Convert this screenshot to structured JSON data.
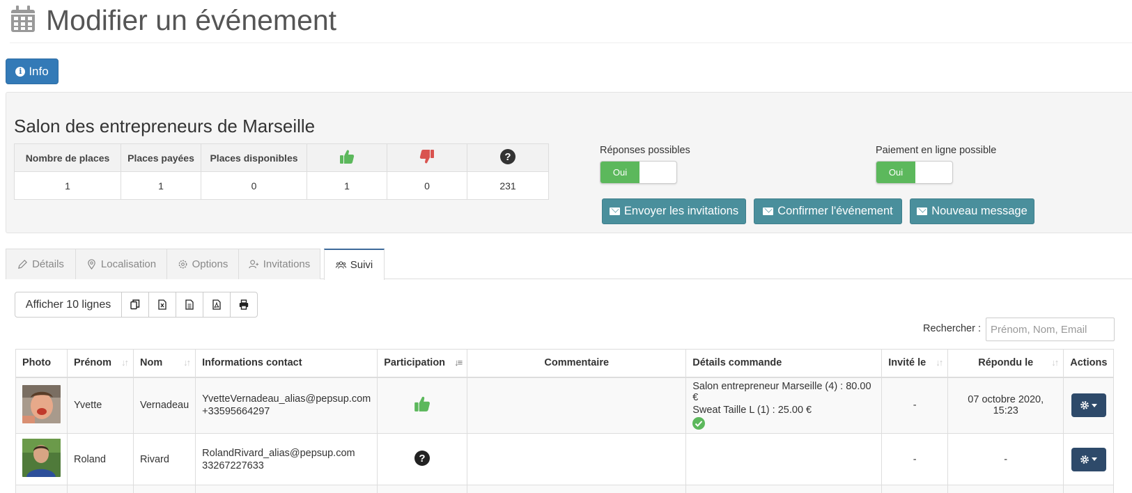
{
  "header": {
    "title": "Modifier un événement",
    "icon": "calendar-icon"
  },
  "info_button": {
    "label": "Info",
    "icon": "info-circle-icon"
  },
  "event": {
    "name": "Salon des entrepreneurs de Marseille",
    "stats_headers": [
      "Nombre de places",
      "Places payées",
      "Places disponibles"
    ],
    "stats_icons": [
      "thumbs-up-icon",
      "thumbs-down-icon",
      "question-circle-icon"
    ],
    "stats_values": [
      "1",
      "1",
      "0",
      "1",
      "0",
      "231"
    ]
  },
  "settings": {
    "responses_label": "Réponses possibles",
    "responses_value": "Oui",
    "payment_label": "Paiement en ligne possible",
    "payment_value": "Oui"
  },
  "actions": {
    "send_invitations": "Envoyer les invitations",
    "confirm_event": "Confirmer l'événement",
    "new_message": "Nouveau message"
  },
  "tabs": [
    {
      "label": "Détails",
      "icon": "pencil-icon"
    },
    {
      "label": "Localisation",
      "icon": "map-pin-icon"
    },
    {
      "label": "Options",
      "icon": "cog-icon"
    },
    {
      "label": "Invitations",
      "icon": "user-plus-icon"
    },
    {
      "label": "Suivi",
      "icon": "users-icon",
      "active": true
    }
  ],
  "table_tools": {
    "show_rows": "Afficher 10 lignes",
    "icons": [
      "copy-icon",
      "excel-icon",
      "csv-icon",
      "pdf-icon",
      "print-icon"
    ]
  },
  "search": {
    "label": "Rechercher :",
    "placeholder": "Prénom, Nom, Email"
  },
  "columns": [
    "Photo",
    "Prénom",
    "Nom",
    "Informations contact",
    "Participation",
    "Commentaire",
    "Détails commande",
    "Invité le",
    "Répondu le",
    "Actions"
  ],
  "rows": [
    {
      "first_name": "Yvette",
      "last_name": "Vernadeau",
      "email": "YvetteVernadeau_alias@pepsup.com",
      "phone": "+33595664297",
      "participation": "thumbs-up-icon",
      "comment": "",
      "order_line1": "Salon entrepreneur Marseille (4) : 80.00 €",
      "order_line2": "Sweat Taille L (1) : 25.00 €",
      "order_status": "check-circle-icon",
      "invited": "-",
      "replied": "07 octobre 2020, 15:23"
    },
    {
      "first_name": "Roland",
      "last_name": "Rivard",
      "email": "RolandRivard_alias@pepsup.com",
      "phone": "33267227633",
      "participation": "question-circle-icon",
      "comment": "",
      "order_line1": "",
      "order_line2": "",
      "invited": "-",
      "replied": "-"
    }
  ],
  "colors": {
    "primary": "#337ab7",
    "teal": "#4a8f9c",
    "success": "#5cb85c",
    "danger": "#d9534f",
    "navy": "#2e4a6a"
  }
}
